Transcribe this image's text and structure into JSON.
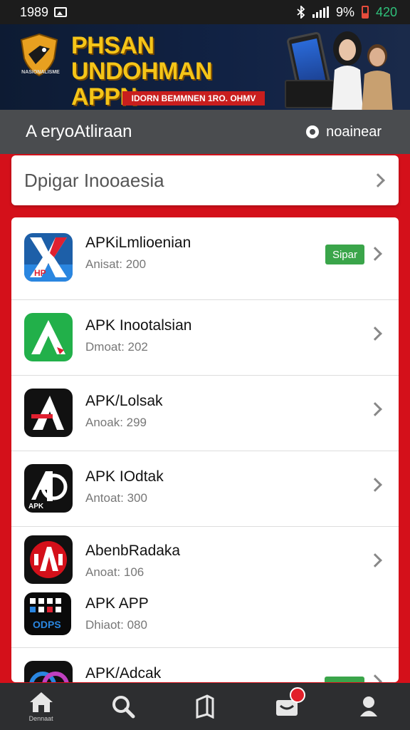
{
  "status_bar": {
    "time": "1989",
    "battery_percent": "9%",
    "battery_value": "420"
  },
  "banner": {
    "logo_text": "NASIONALISME",
    "title_line1": "PHSAN UNDOHMAN",
    "title_line2": "APPN INDONOESIA",
    "subtitle": "IDORN BEMMNEN 1RO. OHMV"
  },
  "header": {
    "title": "A eryoAtliraan",
    "action_label": "noainear"
  },
  "search": {
    "text": "Dpigar Inooaesia"
  },
  "apps": [
    {
      "name": "APKiLmlioenian",
      "meta": "Anisat: 200",
      "badge": "Sipar"
    },
    {
      "name": "APK Inootalsian",
      "meta": "Dmoat: 202"
    },
    {
      "name": "APK/Lolsak",
      "meta": "Anoak: 299"
    },
    {
      "name": "APK IOdtak",
      "meta": "Antoat: 300"
    },
    {
      "name": "AbenbRadaka",
      "meta": "Anoat: 106"
    },
    {
      "name": "APK APP",
      "meta": "Dhiaot: 080"
    },
    {
      "name": "APK/Adcak",
      "meta": ""
    }
  ],
  "bottom_nav": {
    "home_label": "Dennaat"
  },
  "icons": [
    "image-icon",
    "bluetooth-icon",
    "signal-icon",
    "battery-icon",
    "ring-icon",
    "chevron-right-icon",
    "home-icon",
    "search-icon",
    "bookmark-icon",
    "inbox-icon",
    "profile-icon"
  ],
  "colors": {
    "accent_red": "#d4101a",
    "header_gray": "#4a4c4f",
    "badge_green": "#3aa54a",
    "banner_title": "#f5c518"
  }
}
